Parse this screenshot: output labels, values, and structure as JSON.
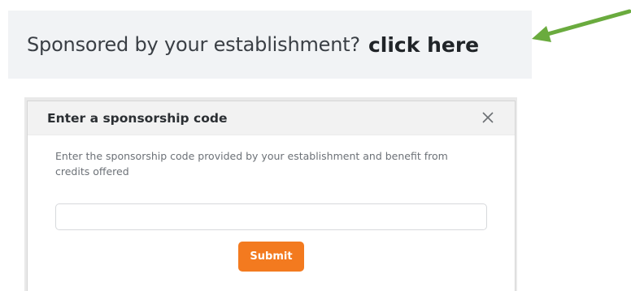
{
  "banner": {
    "text": "Sponsored by your establishment?",
    "link_label": "click here"
  },
  "annotation": {
    "arrow_icon": "arrow-pointing-left-icon",
    "arrow_color": "#6aab3e"
  },
  "modal": {
    "title": "Enter a sponsorship code",
    "close_icon": "close-icon",
    "description": "Enter the sponsorship code provided by your establishment and benefit from credits offered",
    "input": {
      "value": "",
      "placeholder": ""
    },
    "submit_label": "Submit",
    "submit_color": "#f37a1f"
  }
}
